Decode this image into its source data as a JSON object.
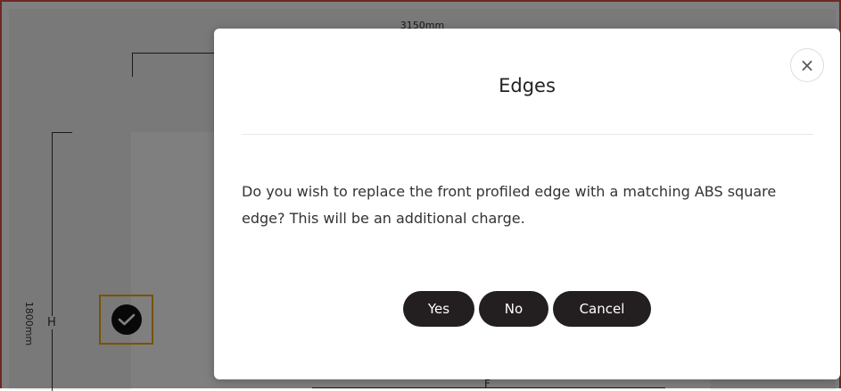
{
  "background": {
    "width_dimension": "3150mm",
    "height_dimension": "1800mm",
    "height_letter": "H",
    "front_letter": "F"
  },
  "modal": {
    "title": "Edges",
    "close_symbol": "×",
    "body": "Do you wish to replace the front profiled edge with a matching ABS square edge? This will be an additional charge.",
    "buttons": {
      "yes": "Yes",
      "no": "No",
      "cancel": "Cancel"
    }
  },
  "icons": {
    "check": "check-circle-icon",
    "close": "close-icon"
  },
  "colors": {
    "button_bg": "#231f20",
    "selection_border": "#f0a500",
    "frame_border": "#d9534f"
  }
}
